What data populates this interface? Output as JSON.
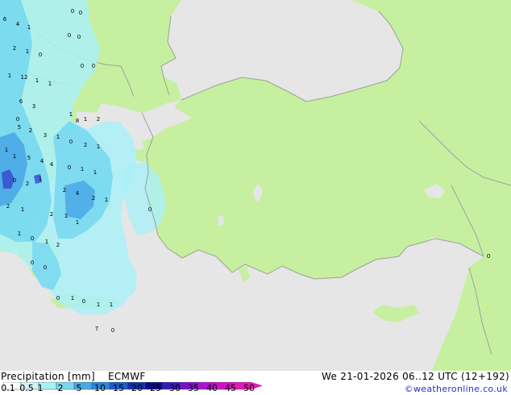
{
  "map": {
    "title": "Precipitation [mm]",
    "model": "ECMWF",
    "datetime": "We 21-01-2026 06..12 UTC (12+192)",
    "credit": "©weatheronline.co.uk",
    "colors": {
      "sea": "#e6e6e6",
      "land": "#c6f0a0",
      "border": "#a0a0a0",
      "coast": "#888888",
      "precip_light": "#aaf0f8",
      "precip_mid": "#78d8f0",
      "precip_heavy": "#4aa8e6",
      "precip_core": "#3c5ad2"
    },
    "legend": {
      "ticks": [
        "0.1",
        "0.5",
        "1",
        "2",
        "5",
        "10",
        "15",
        "20",
        "25",
        "30",
        "35",
        "40",
        "45",
        "50"
      ],
      "colors": [
        "#ffffff",
        "#cff3f5",
        "#aaf0f8",
        "#78d8f0",
        "#4aa8e6",
        "#2a86d6",
        "#1a5cc8",
        "#1030a8",
        "#0a0a90",
        "#3a1ab4",
        "#7a10c8",
        "#b010d0",
        "#d010c8",
        "#e01ab4"
      ]
    },
    "amounts": [
      "6",
      "4",
      "1",
      "0",
      "0",
      "0",
      "2",
      "1",
      "0",
      "0",
      "0",
      "0",
      "1",
      "12",
      "1",
      "1",
      "6",
      "3",
      "0",
      "5",
      "2",
      "3",
      "1",
      "1",
      "8",
      "1",
      "2",
      "1",
      "1",
      "5",
      "4",
      "4",
      "0",
      "2",
      "1",
      "0",
      "1",
      "1",
      "0",
      "2",
      "1",
      "2",
      "4",
      "2",
      "1",
      "2",
      "1",
      "2",
      "1",
      "1",
      "1",
      "0",
      "1",
      "2",
      "0",
      "0",
      "0",
      "1",
      "0",
      "1",
      "1",
      "7",
      "0",
      "0",
      "0"
    ]
  }
}
